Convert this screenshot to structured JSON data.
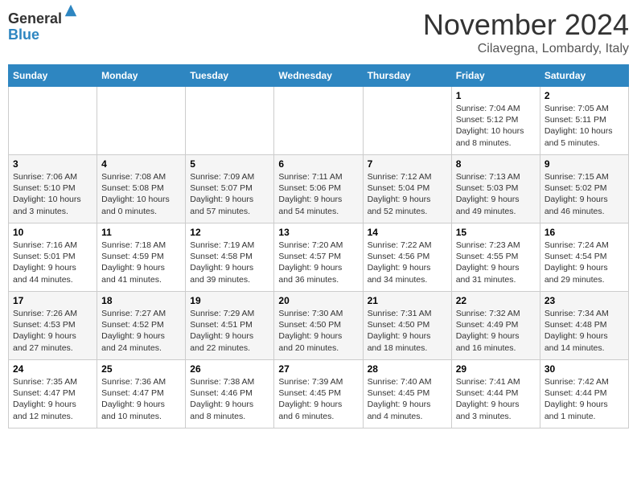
{
  "logo": {
    "general": "General",
    "blue": "Blue"
  },
  "title": {
    "month": "November 2024",
    "location": "Cilavegna, Lombardy, Italy"
  },
  "weekdays": [
    "Sunday",
    "Monday",
    "Tuesday",
    "Wednesday",
    "Thursday",
    "Friday",
    "Saturday"
  ],
  "weeks": [
    [
      {
        "day": "",
        "info": ""
      },
      {
        "day": "",
        "info": ""
      },
      {
        "day": "",
        "info": ""
      },
      {
        "day": "",
        "info": ""
      },
      {
        "day": "",
        "info": ""
      },
      {
        "day": "1",
        "info": "Sunrise: 7:04 AM\nSunset: 5:12 PM\nDaylight: 10 hours and 8 minutes."
      },
      {
        "day": "2",
        "info": "Sunrise: 7:05 AM\nSunset: 5:11 PM\nDaylight: 10 hours and 5 minutes."
      }
    ],
    [
      {
        "day": "3",
        "info": "Sunrise: 7:06 AM\nSunset: 5:10 PM\nDaylight: 10 hours and 3 minutes."
      },
      {
        "day": "4",
        "info": "Sunrise: 7:08 AM\nSunset: 5:08 PM\nDaylight: 10 hours and 0 minutes."
      },
      {
        "day": "5",
        "info": "Sunrise: 7:09 AM\nSunset: 5:07 PM\nDaylight: 9 hours and 57 minutes."
      },
      {
        "day": "6",
        "info": "Sunrise: 7:11 AM\nSunset: 5:06 PM\nDaylight: 9 hours and 54 minutes."
      },
      {
        "day": "7",
        "info": "Sunrise: 7:12 AM\nSunset: 5:04 PM\nDaylight: 9 hours and 52 minutes."
      },
      {
        "day": "8",
        "info": "Sunrise: 7:13 AM\nSunset: 5:03 PM\nDaylight: 9 hours and 49 minutes."
      },
      {
        "day": "9",
        "info": "Sunrise: 7:15 AM\nSunset: 5:02 PM\nDaylight: 9 hours and 46 minutes."
      }
    ],
    [
      {
        "day": "10",
        "info": "Sunrise: 7:16 AM\nSunset: 5:01 PM\nDaylight: 9 hours and 44 minutes."
      },
      {
        "day": "11",
        "info": "Sunrise: 7:18 AM\nSunset: 4:59 PM\nDaylight: 9 hours and 41 minutes."
      },
      {
        "day": "12",
        "info": "Sunrise: 7:19 AM\nSunset: 4:58 PM\nDaylight: 9 hours and 39 minutes."
      },
      {
        "day": "13",
        "info": "Sunrise: 7:20 AM\nSunset: 4:57 PM\nDaylight: 9 hours and 36 minutes."
      },
      {
        "day": "14",
        "info": "Sunrise: 7:22 AM\nSunset: 4:56 PM\nDaylight: 9 hours and 34 minutes."
      },
      {
        "day": "15",
        "info": "Sunrise: 7:23 AM\nSunset: 4:55 PM\nDaylight: 9 hours and 31 minutes."
      },
      {
        "day": "16",
        "info": "Sunrise: 7:24 AM\nSunset: 4:54 PM\nDaylight: 9 hours and 29 minutes."
      }
    ],
    [
      {
        "day": "17",
        "info": "Sunrise: 7:26 AM\nSunset: 4:53 PM\nDaylight: 9 hours and 27 minutes."
      },
      {
        "day": "18",
        "info": "Sunrise: 7:27 AM\nSunset: 4:52 PM\nDaylight: 9 hours and 24 minutes."
      },
      {
        "day": "19",
        "info": "Sunrise: 7:29 AM\nSunset: 4:51 PM\nDaylight: 9 hours and 22 minutes."
      },
      {
        "day": "20",
        "info": "Sunrise: 7:30 AM\nSunset: 4:50 PM\nDaylight: 9 hours and 20 minutes."
      },
      {
        "day": "21",
        "info": "Sunrise: 7:31 AM\nSunset: 4:50 PM\nDaylight: 9 hours and 18 minutes."
      },
      {
        "day": "22",
        "info": "Sunrise: 7:32 AM\nSunset: 4:49 PM\nDaylight: 9 hours and 16 minutes."
      },
      {
        "day": "23",
        "info": "Sunrise: 7:34 AM\nSunset: 4:48 PM\nDaylight: 9 hours and 14 minutes."
      }
    ],
    [
      {
        "day": "24",
        "info": "Sunrise: 7:35 AM\nSunset: 4:47 PM\nDaylight: 9 hours and 12 minutes."
      },
      {
        "day": "25",
        "info": "Sunrise: 7:36 AM\nSunset: 4:47 PM\nDaylight: 9 hours and 10 minutes."
      },
      {
        "day": "26",
        "info": "Sunrise: 7:38 AM\nSunset: 4:46 PM\nDaylight: 9 hours and 8 minutes."
      },
      {
        "day": "27",
        "info": "Sunrise: 7:39 AM\nSunset: 4:45 PM\nDaylight: 9 hours and 6 minutes."
      },
      {
        "day": "28",
        "info": "Sunrise: 7:40 AM\nSunset: 4:45 PM\nDaylight: 9 hours and 4 minutes."
      },
      {
        "day": "29",
        "info": "Sunrise: 7:41 AM\nSunset: 4:44 PM\nDaylight: 9 hours and 3 minutes."
      },
      {
        "day": "30",
        "info": "Sunrise: 7:42 AM\nSunset: 4:44 PM\nDaylight: 9 hours and 1 minute."
      }
    ]
  ]
}
